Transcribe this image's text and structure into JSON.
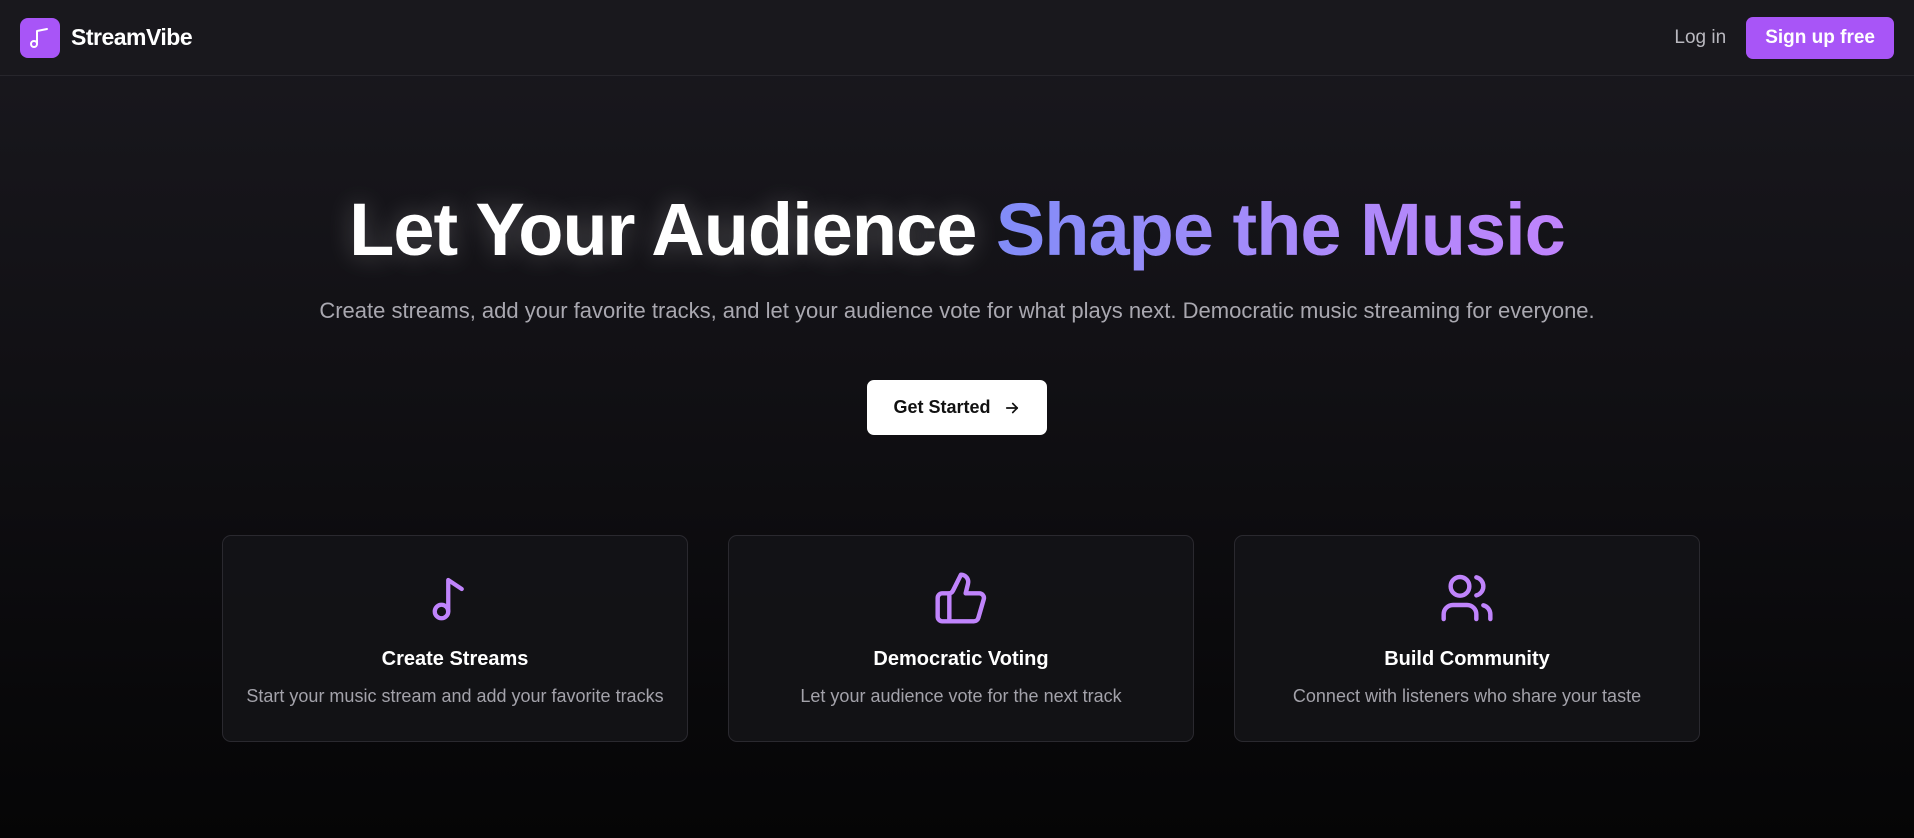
{
  "brand": {
    "name": "StreamVibe",
    "logo_icon": "music-note-icon",
    "color": "#a855f7"
  },
  "nav": {
    "login_label": "Log in",
    "signup_label": "Sign up free"
  },
  "hero": {
    "title_plain": "Let Your Audience ",
    "title_accent": "Shape the Music",
    "subtitle": "Create streams, add your favorite tracks, and let your audience vote for what plays next. Democratic music streaming for everyone.",
    "cta_label": "Get Started",
    "cta_icon": "arrow-right-icon"
  },
  "features": [
    {
      "icon": "music-note-icon",
      "title": "Create Streams",
      "description": "Start your music stream and add your favorite tracks"
    },
    {
      "icon": "thumbs-up-icon",
      "title": "Democratic Voting",
      "description": "Let your audience vote for the next track"
    },
    {
      "icon": "users-icon",
      "title": "Build Community",
      "description": "Connect with listeners who share your taste"
    }
  ],
  "colors": {
    "accent": "#a855f7",
    "accent_gradient_start": "#818cf8",
    "accent_gradient_end": "#c084fc",
    "icon": "#c084fc"
  }
}
